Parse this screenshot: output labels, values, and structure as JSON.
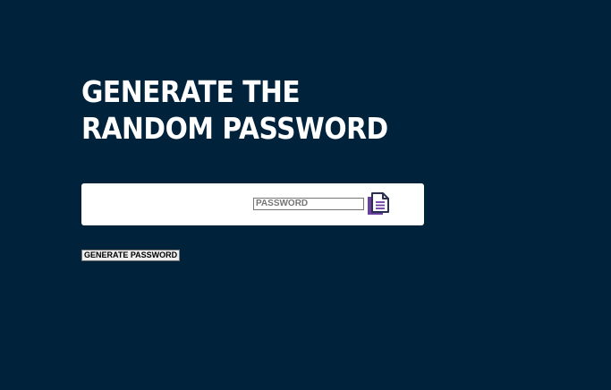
{
  "header": {
    "title": "GENERATE THE RANDOM PASSWORD"
  },
  "password_field": {
    "value": "",
    "placeholder": "PASSWORD"
  },
  "copy_button": {
    "icon": "copy-icon"
  },
  "generate_button": {
    "label": "GENERATE PASSWORD"
  },
  "colors": {
    "background": "#01223b",
    "card": "#ffffff",
    "icon_primary": "#6b3fa0",
    "icon_outline": "#2b2f4f"
  }
}
